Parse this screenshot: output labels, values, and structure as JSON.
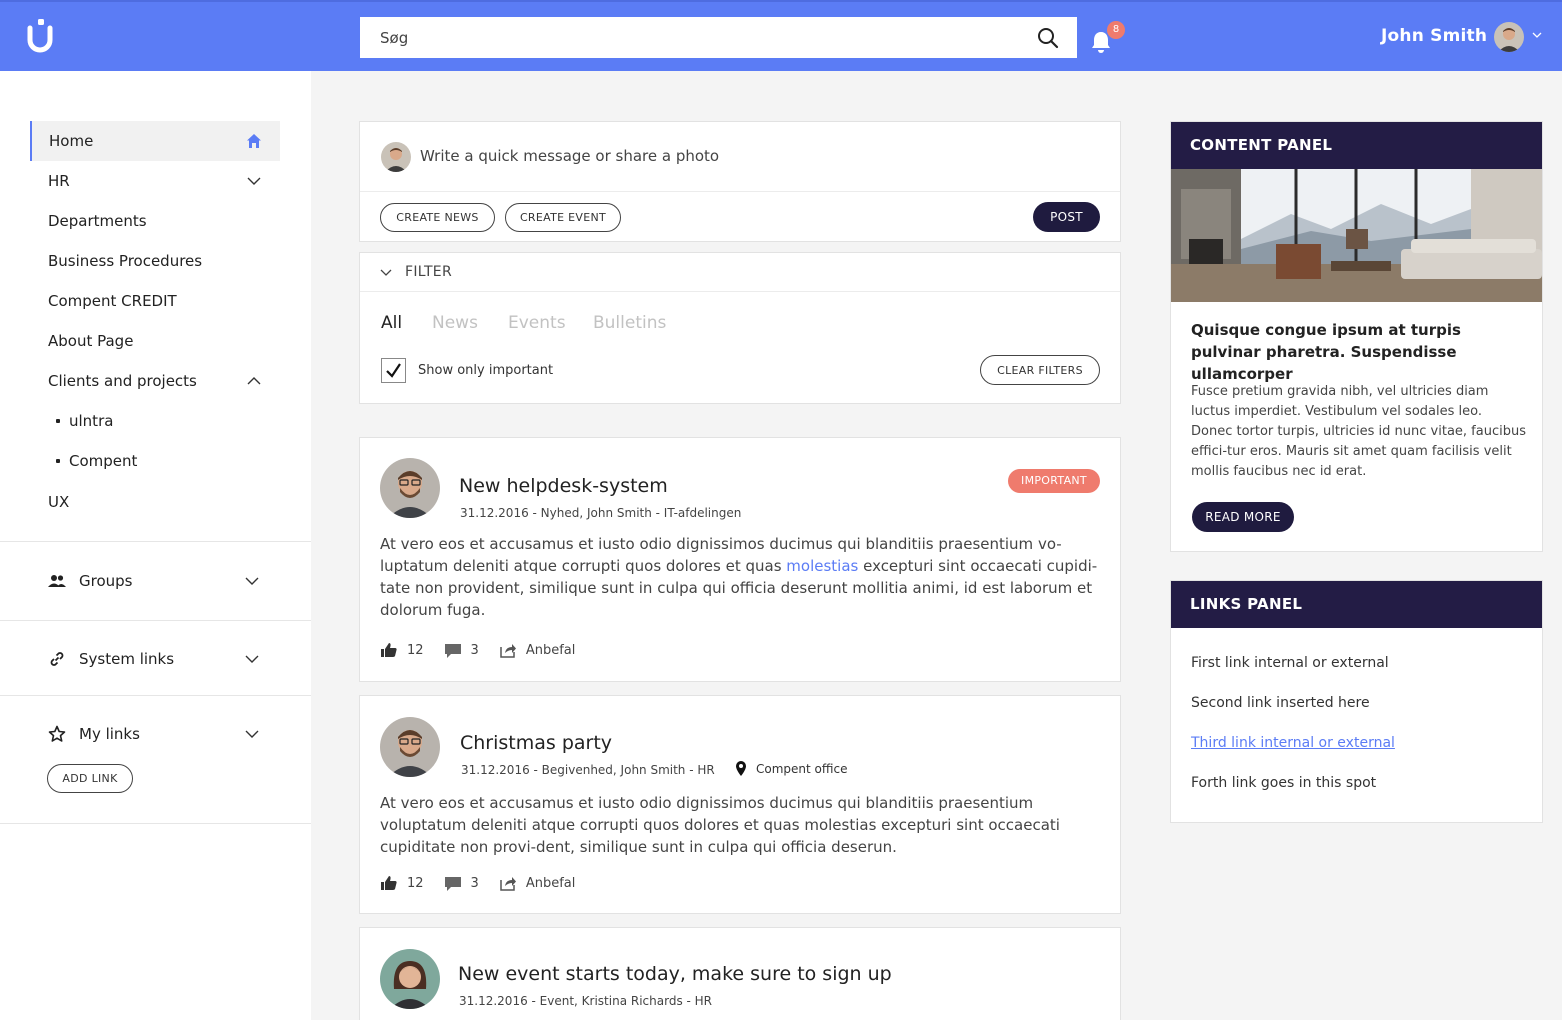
{
  "header": {
    "search_placeholder": "Søg",
    "notification_count": "8",
    "user_name": "John Smith",
    "accent_color": "#5b7cf5"
  },
  "sidebar": {
    "items": [
      {
        "label": "Home",
        "icon": "home-icon"
      },
      {
        "label": "HR",
        "icon": "chevron-down-icon"
      },
      {
        "label": "Departments"
      },
      {
        "label": "Business Procedures"
      },
      {
        "label": "Compent CREDIT"
      },
      {
        "label": "About Page"
      },
      {
        "label": "Clients and projects",
        "icon": "chevron-up-icon"
      }
    ],
    "sub_items": [
      "ulntra",
      "Compent"
    ],
    "ux_label": "UX",
    "sections": [
      {
        "label": "Groups",
        "icon": "group-icon"
      },
      {
        "label": "System links",
        "icon": "link-icon"
      },
      {
        "label": "My links",
        "icon": "star-icon"
      }
    ],
    "add_link_label": "ADD LINK"
  },
  "composer": {
    "placeholder": "Write a quick message or share a photo",
    "create_news": "CREATE NEWS",
    "create_event": "CREATE EVENT",
    "post": "POST"
  },
  "filter": {
    "title": "FILTER",
    "tabs": [
      "All",
      "News",
      "Events",
      "Bulletins"
    ],
    "active_tab": "All",
    "show_only_important": "Show only important",
    "show_only_important_checked": true,
    "clear_filters": "CLEAR FILTERS"
  },
  "posts": [
    {
      "title": "New helpdesk-system",
      "meta": "31.12.2016 - Nyhed, John Smith - IT-afdelingen",
      "badge": "IMPORTANT",
      "body_before": "At vero eos et accusamus et iusto odio dignissimos ducimus qui blanditiis praesentium vo-luptatum deleniti atque corrupti quos dolores et quas ",
      "body_link": "molestias ",
      "body_after": "excepturi sint occaecati cupidi-tate non provident, similique sunt in culpa qui officia deserunt mollitia animi, id est laborum et dolorum fuga.",
      "likes": "12",
      "comments": "3",
      "recommend": "Anbefal"
    },
    {
      "title": "Christmas party",
      "meta": "31.12.2016 - Begivenhed, John Smith - HR",
      "location": "Compent office",
      "body": "At vero eos et accusamus et iusto odio dignissimos ducimus qui blanditiis praesentium voluptatum deleniti atque corrupti quos dolores et quas molestias excepturi sint occaecati cupiditate non provi-dent, similique sunt in culpa qui officia deserun.",
      "likes": "12",
      "comments": "3",
      "recommend": "Anbefal"
    },
    {
      "title": "New event starts today, make sure to sign up",
      "meta": "31.12.2016 - Event, Kristina Richards - HR"
    }
  ],
  "content_panel": {
    "title": "CONTENT PANEL",
    "headline": "Quisque congue ipsum at turpis pulvinar pharetra. Suspendisse ullamcorper",
    "text": "Fusce pretium gravida nibh, vel ultricies diam luctus imperdiet. Vestibulum vel sodales leo. Donec tortor turpis, ultricies id nunc vitae, faucibus effici-tur eros. Mauris sit amet quam facilisis velit mollis faucibus nec id erat.",
    "read_more": "READ MORE"
  },
  "links_panel": {
    "title": "LINKS PANEL",
    "links": [
      "First link internal or external",
      "Second link inserted here",
      "Third link internal or external",
      "Forth link goes in this spot"
    ]
  }
}
